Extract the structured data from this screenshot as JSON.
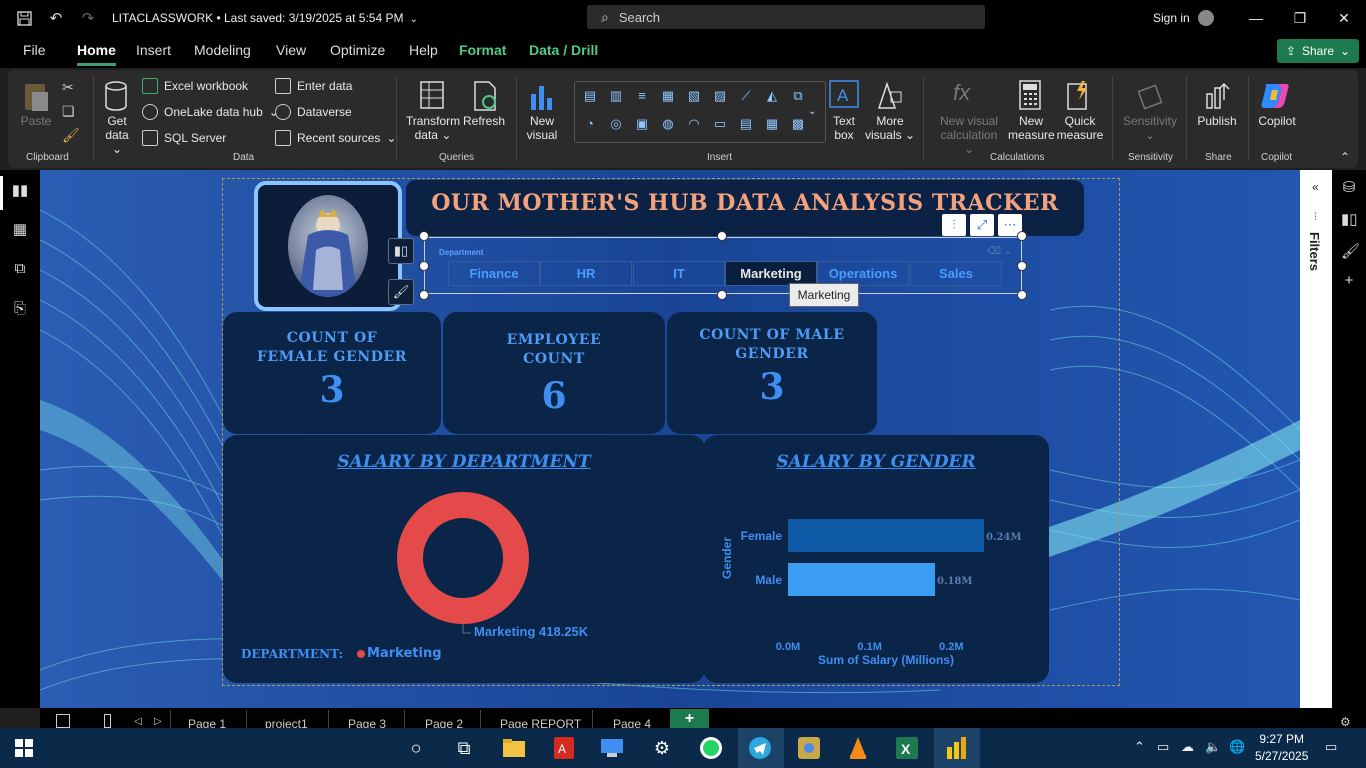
{
  "titlebar": {
    "doc_title": "LITACLASSWORK • Last saved: 3/19/2025 at 5:54 PM",
    "search_placeholder": "Search",
    "sign_in": "Sign in"
  },
  "menu": {
    "items": [
      "File",
      "Home",
      "Insert",
      "Modeling",
      "View",
      "Optimize",
      "Help",
      "Format",
      "Data / Drill"
    ],
    "active": "Home",
    "share": "Share"
  },
  "ribbon": {
    "paste": "Paste",
    "clipboard_label": "Clipboard",
    "get_data": "Get",
    "get_data2": "data",
    "excel_workbook": "Excel workbook",
    "onelake": "OneLake data hub",
    "sql_server": "SQL Server",
    "enter_data": "Enter data",
    "dataverse": "Dataverse",
    "recent_sources": "Recent sources",
    "data_label": "Data",
    "transform": "Transform",
    "transform2": "data",
    "refresh": "Refresh",
    "queries_label": "Queries",
    "new_visual": "New",
    "new_visual2": "visual",
    "text_box": "Text",
    "text_box2": "box",
    "more_visuals": "More",
    "more_visuals2": "visuals",
    "insert_label": "Insert",
    "new_visual_calc": "New visual",
    "new_visual_calc2": "calculation",
    "new_measure": "New",
    "new_measure2": "measure",
    "quick_measure": "Quick",
    "quick_measure2": "measure",
    "calculations_label": "Calculations",
    "sensitivity": "Sensitivity",
    "sensitivity_label": "Sensitivity",
    "publish": "Publish",
    "share_label": "Share",
    "copilot": "Copilot",
    "copilot_label": "Copilot"
  },
  "panes": {
    "filters": "Filters"
  },
  "report": {
    "title": "OUR MOTHER'S HUB DATA ANALYSIS TRACKER",
    "slicer": {
      "label": "Department",
      "options": [
        "Finance",
        "HR",
        "IT",
        "Marketing",
        "Operations",
        "Sales"
      ],
      "selected": "Marketing",
      "tooltip": "Marketing"
    },
    "cards": [
      {
        "title": "COUNT OF FEMALE GENDER",
        "value": "3"
      },
      {
        "title": "EMPLOYEE COUNT",
        "value": "6"
      },
      {
        "title": "COUNT OF MALE GENDER",
        "value": "3"
      }
    ],
    "donut": {
      "title": "SALARY BY DEPARTMENT",
      "data_label": "Marketing 418.25K",
      "legend_title": "DEPARTMENT:",
      "legend_item": "Marketing",
      "color": "#e44a4a"
    },
    "gender_chart": {
      "title": "SALARY BY GENDER",
      "ylabel": "Gender",
      "xlabel": "Sum of Salary (Millions)",
      "xticks": [
        "0.0M",
        "0.1M",
        "0.2M"
      ]
    }
  },
  "chart_data": [
    {
      "type": "pie",
      "title": "SALARY BY DEPARTMENT",
      "categories": [
        "Marketing"
      ],
      "values": [
        418.25
      ],
      "unit": "K"
    },
    {
      "type": "bar",
      "orientation": "horizontal",
      "title": "SALARY BY GENDER",
      "categories": [
        "Female",
        "Male"
      ],
      "values": [
        0.24,
        0.18
      ],
      "value_labels": [
        "0.24M",
        "0.18M"
      ],
      "xlabel": "Sum of Salary (Millions)",
      "ylabel": "Gender",
      "xlim": [
        0,
        0.24
      ],
      "colors": [
        "#0f5aa6",
        "#3a9df2"
      ]
    }
  ],
  "pages": {
    "tabs": [
      "Page 1",
      "project1",
      "Page 3",
      "Page 2",
      "Page REPORT",
      "Page 4"
    ],
    "add": "+"
  },
  "taskbar": {
    "time": "9:27 PM",
    "date": "5/27/2025"
  }
}
